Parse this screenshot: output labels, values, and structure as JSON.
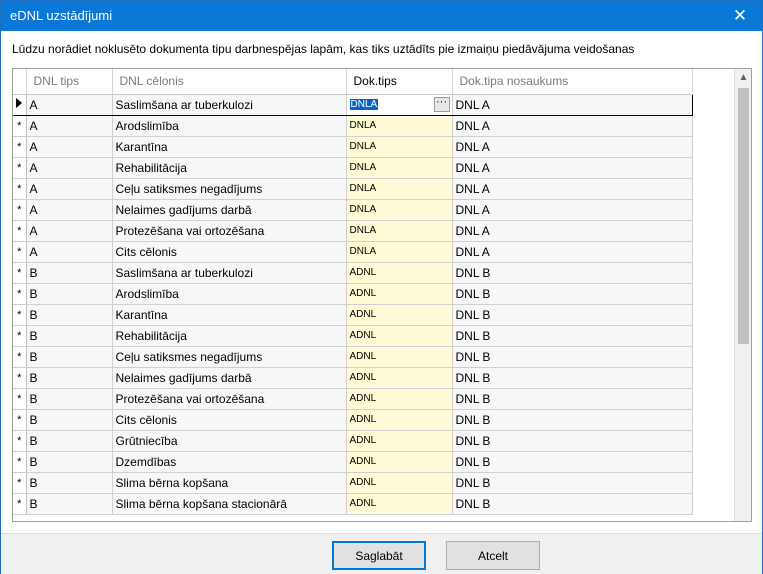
{
  "window": {
    "title": "eDNL uzstādījumi",
    "close_glyph": "✕"
  },
  "instruction": "Lūdzu norādiet noklusēto dokumenta tipu darbnespējas lapām, kas tiks uztādīts pie izmaiņu piedāvājuma veidošanas",
  "grid": {
    "columns": [
      "DNL tips",
      "DNL cēlonis",
      "Dok.tips",
      "Dok.tipa nosaukums"
    ],
    "rows": [
      {
        "indicator": "current",
        "tips": "A",
        "celonis": "Saslimšana ar tuberkulozi",
        "dok_tips": "DNLA",
        "dok_nos": "DNL A"
      },
      {
        "indicator": "*",
        "tips": "A",
        "celonis": "Arodslimība",
        "dok_tips": "DNLA",
        "dok_nos": "DNL A"
      },
      {
        "indicator": "*",
        "tips": "A",
        "celonis": "Karantīna",
        "dok_tips": "DNLA",
        "dok_nos": "DNL A"
      },
      {
        "indicator": "*",
        "tips": "A",
        "celonis": "Rehabilitācija",
        "dok_tips": "DNLA",
        "dok_nos": "DNL A"
      },
      {
        "indicator": "*",
        "tips": "A",
        "celonis": "Ceļu satiksmes negadījums",
        "dok_tips": "DNLA",
        "dok_nos": "DNL A"
      },
      {
        "indicator": "*",
        "tips": "A",
        "celonis": "Nelaimes gadījums darbā",
        "dok_tips": "DNLA",
        "dok_nos": "DNL A"
      },
      {
        "indicator": "*",
        "tips": "A",
        "celonis": "Protezēšana vai ortozēšana",
        "dok_tips": "DNLA",
        "dok_nos": "DNL A"
      },
      {
        "indicator": "*",
        "tips": "A",
        "celonis": "Cits cēlonis",
        "dok_tips": "DNLA",
        "dok_nos": "DNL A"
      },
      {
        "indicator": "*",
        "tips": "B",
        "celonis": "Saslimšana ar tuberkulozi",
        "dok_tips": "ADNL",
        "dok_nos": "DNL B"
      },
      {
        "indicator": "*",
        "tips": "B",
        "celonis": "Arodslimība",
        "dok_tips": "ADNL",
        "dok_nos": "DNL B"
      },
      {
        "indicator": "*",
        "tips": "B",
        "celonis": "Karantīna",
        "dok_tips": "ADNL",
        "dok_nos": "DNL B"
      },
      {
        "indicator": "*",
        "tips": "B",
        "celonis": "Rehabilitācija",
        "dok_tips": "ADNL",
        "dok_nos": "DNL B"
      },
      {
        "indicator": "*",
        "tips": "B",
        "celonis": "Ceļu satiksmes negadījums",
        "dok_tips": "ADNL",
        "dok_nos": "DNL B"
      },
      {
        "indicator": "*",
        "tips": "B",
        "celonis": "Nelaimes gadījums darbā",
        "dok_tips": "ADNL",
        "dok_nos": "DNL B"
      },
      {
        "indicator": "*",
        "tips": "B",
        "celonis": "Protezēšana vai ortozēšana",
        "dok_tips": "ADNL",
        "dok_nos": "DNL B"
      },
      {
        "indicator": "*",
        "tips": "B",
        "celonis": "Cits cēlonis",
        "dok_tips": "ADNL",
        "dok_nos": "DNL B"
      },
      {
        "indicator": "*",
        "tips": "B",
        "celonis": "Grūtniecība",
        "dok_tips": "ADNL",
        "dok_nos": "DNL B"
      },
      {
        "indicator": "*",
        "tips": "B",
        "celonis": "Dzemdības",
        "dok_tips": "ADNL",
        "dok_nos": "DNL B"
      },
      {
        "indicator": "*",
        "tips": "B",
        "celonis": "Slima bērna kopšana",
        "dok_tips": "ADNL",
        "dok_nos": "DNL B"
      },
      {
        "indicator": "*",
        "tips": "B",
        "celonis": "Slima bērna kopšana stacionārā",
        "dok_tips": "ADNL",
        "dok_nos": "DNL B"
      }
    ],
    "ellipsis_glyph": "···",
    "scroll_up_glyph": "▲"
  },
  "buttons": {
    "save": "Saglabāt",
    "cancel": "Atcelt"
  },
  "colors": {
    "titlebar": "#0b78d7",
    "editable_cell": "#fffbd6",
    "selection": "#0a64c8"
  }
}
